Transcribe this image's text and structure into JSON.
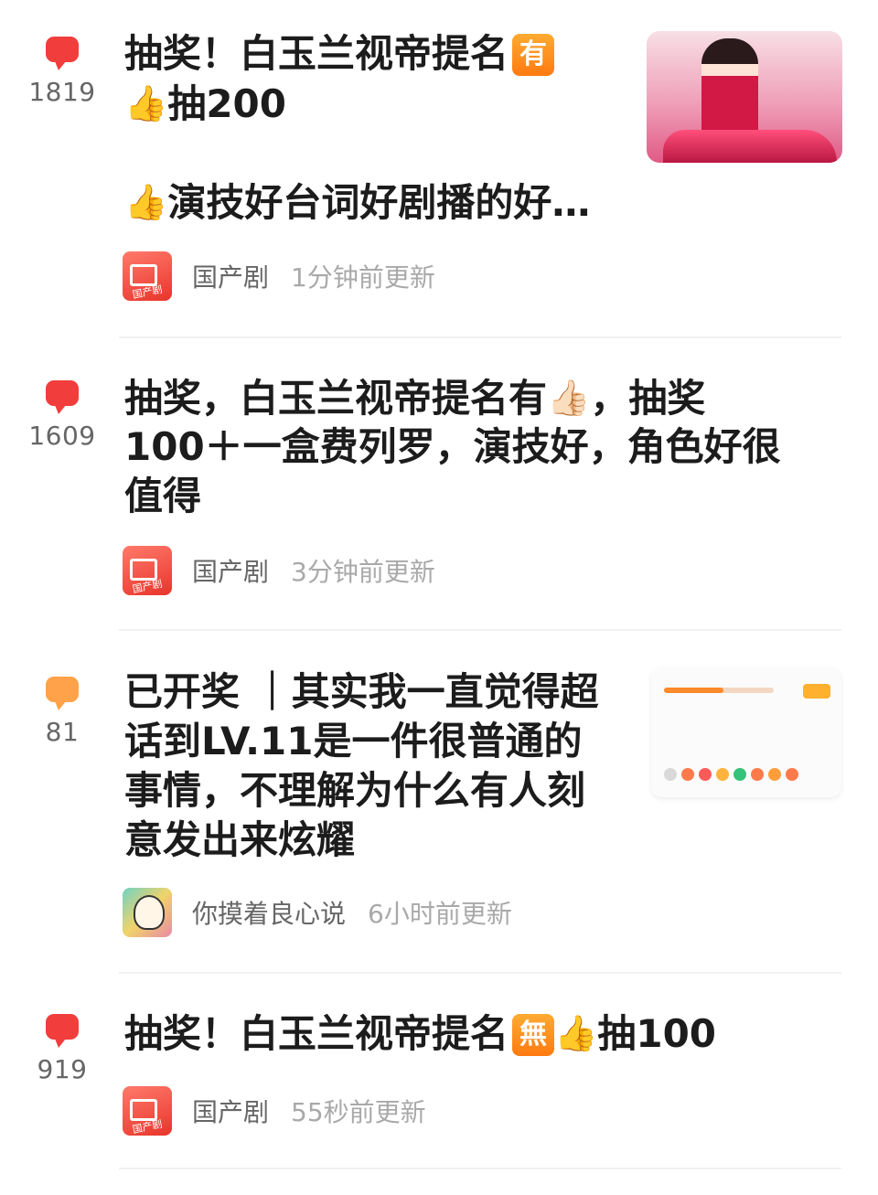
{
  "colors": {
    "hot": "#f23d3d",
    "warm": "#ffa24a",
    "tag": "#ff8c1a",
    "meta_text": "#666666",
    "time_text": "#a9a9a9"
  },
  "posts": [
    {
      "count": "1819",
      "badge_color": "#f23d3d",
      "title_line1": "抽奖！白玉兰视帝提名",
      "tag": "有",
      "title_line2": "抽200",
      "title_line3": "演技好台词好剧播的好…",
      "source": "国产剧",
      "time": "1分钟前更新",
      "avatar_caption": "国产剧",
      "media_icon": "poster-image"
    },
    {
      "count": "1609",
      "badge_color": "#f23d3d",
      "title_line1": "抽奖，白玉兰视帝提名有",
      "title_line1_end": "，抽奖",
      "title_line2": "100＋一盒费列罗，演技好，角色好很",
      "title_line3": "值得",
      "source": "国产剧",
      "time": "3分钟前更新",
      "avatar_caption": "国产剧"
    },
    {
      "count": "81",
      "badge_color": "#ffa24a",
      "title_line1": "已开奖 ｜其实我一直觉得超",
      "title_line2": "话到LV.11是一件很普通的",
      "title_line3": "事情，不理解为什么有人刻",
      "title_line4": "意发出来炫耀",
      "source": "你摸着良心说",
      "time": "6小时前更新",
      "media_icon": "level-card-image"
    },
    {
      "count": "919",
      "badge_color": "#f23d3d",
      "title_line1": "抽奖！白玉兰视帝提名",
      "tag": "無",
      "title_end": "抽100",
      "source": "国产剧",
      "time": "55秒前更新",
      "avatar_caption": "国产剧"
    }
  ]
}
